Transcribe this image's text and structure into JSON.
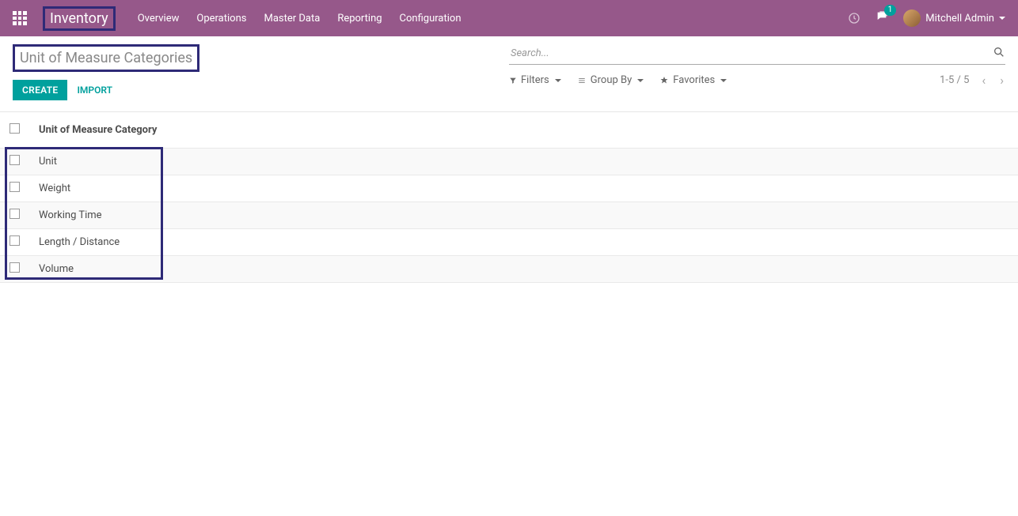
{
  "navbar": {
    "brand": "Inventory",
    "menu": [
      "Overview",
      "Operations",
      "Master Data",
      "Reporting",
      "Configuration"
    ],
    "chat_badge": "1",
    "user_name": "Mitchell Admin"
  },
  "breadcrumb": {
    "title": "Unit of Measure Categories"
  },
  "buttons": {
    "create": "CREATE",
    "import": "IMPORT"
  },
  "search": {
    "placeholder": "Search..."
  },
  "toolbar": {
    "filters": "Filters",
    "group_by": "Group By",
    "favorites": "Favorites",
    "pager": "1-5 / 5"
  },
  "table": {
    "header": "Unit of Measure Category",
    "rows": [
      "Unit",
      "Weight",
      "Working Time",
      "Length / Distance",
      "Volume"
    ]
  }
}
